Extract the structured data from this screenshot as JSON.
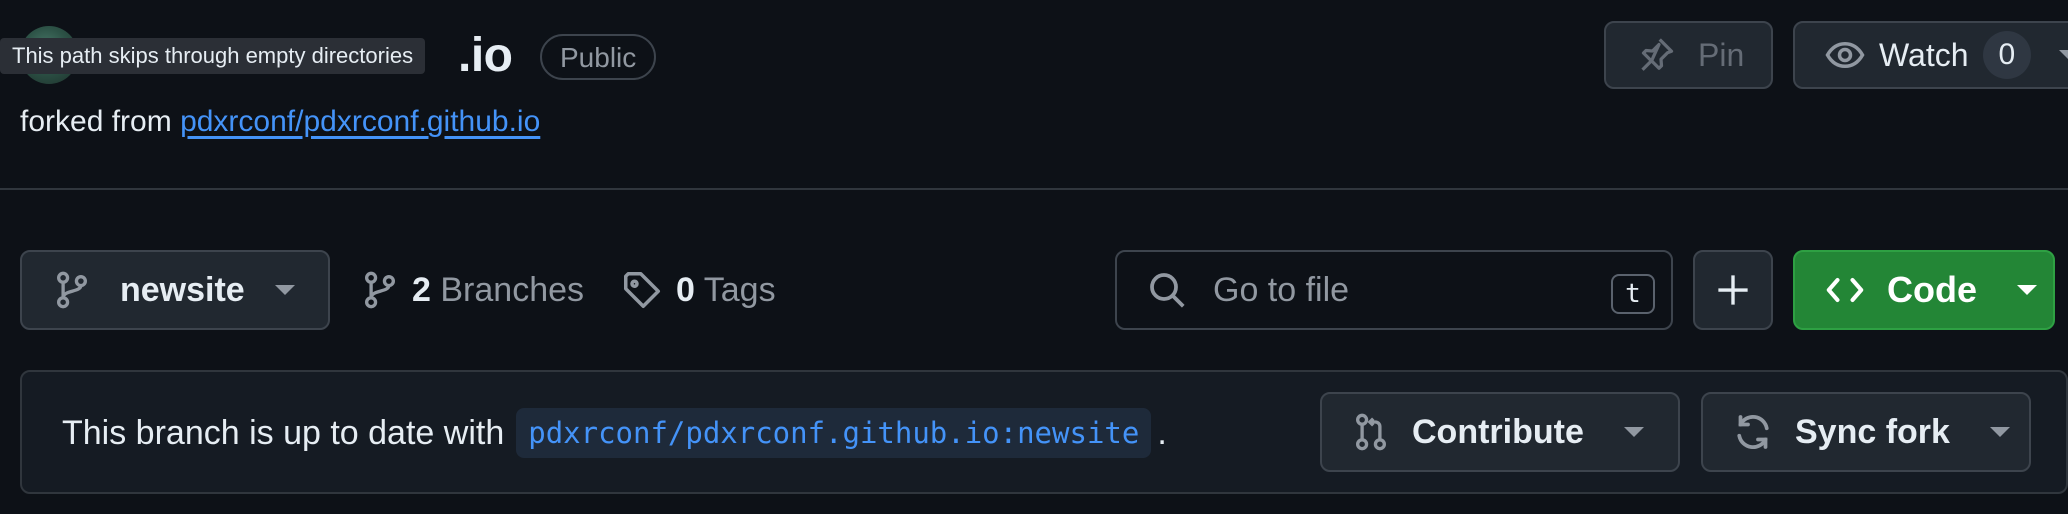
{
  "header": {
    "repo_name_visible": ".io",
    "visibility_badge": "Public",
    "tooltip": "This path skips through empty directories",
    "forked_prefix": "forked from",
    "forked_link": "pdxrconf/pdxrconf.github.io",
    "pin_label": "Pin",
    "watch_label": "Watch",
    "watch_count": "0"
  },
  "toolbar": {
    "branch_name": "newsite",
    "branches_count": "2",
    "branches_label": "Branches",
    "tags_count": "0",
    "tags_label": "Tags",
    "search_placeholder": "Go to file",
    "search_shortcut": "t",
    "code_label": "Code"
  },
  "status": {
    "message": "This branch is up to date with",
    "ref": "pdxrconf/pdxrconf.github.io:newsite",
    "suffix": ".",
    "contribute_label": "Contribute",
    "sync_label": "Sync fork"
  },
  "colors": {
    "background": "#0d1117",
    "accent_link": "#4493f8",
    "code_button": "#238636"
  },
  "icons": [
    "avatar",
    "pin-icon",
    "eye-icon",
    "branch-icon",
    "tag-icon",
    "search-icon",
    "plus-icon",
    "code-icon",
    "pull-request-icon",
    "sync-icon",
    "chevron-down-icon"
  ]
}
